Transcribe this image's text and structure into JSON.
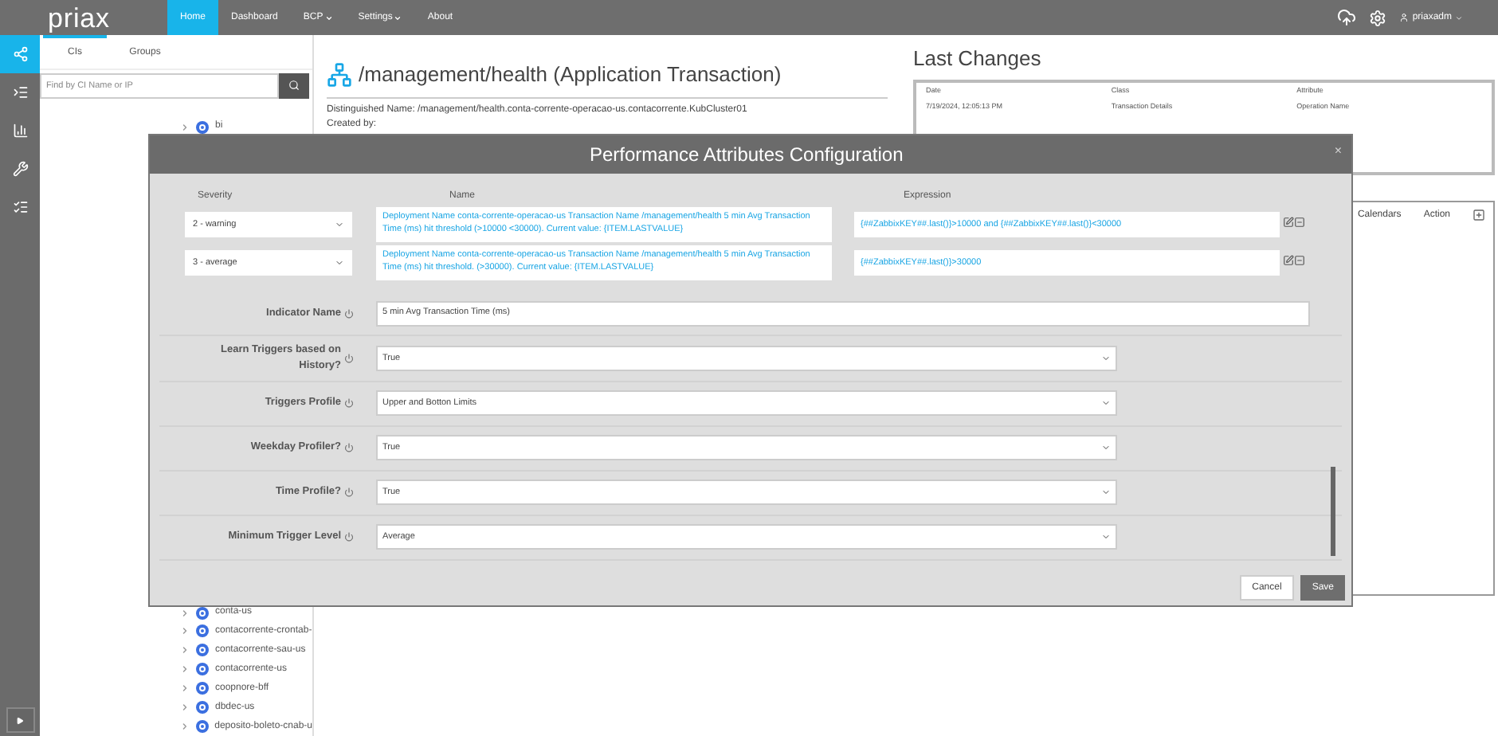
{
  "nav": {
    "logo": "priax",
    "items": [
      {
        "label": "Home",
        "selected": true,
        "dropdown": false
      },
      {
        "label": "Dashboard",
        "selected": false,
        "dropdown": false
      },
      {
        "label": "BCP",
        "selected": false,
        "dropdown": true
      },
      {
        "label": "Settings",
        "selected": false,
        "dropdown": true
      },
      {
        "label": "About",
        "selected": false,
        "dropdown": false
      }
    ],
    "user": "priaxadm"
  },
  "rail": {
    "items": [
      {
        "kind": "share",
        "selected": true
      },
      {
        "kind": "list",
        "selected": false
      },
      {
        "kind": "chart",
        "selected": false
      },
      {
        "kind": "wrench",
        "selected": false
      },
      {
        "kind": "tasks",
        "selected": false
      }
    ]
  },
  "tree": {
    "tabs": [
      {
        "label": "CIs",
        "selected": true
      },
      {
        "label": "Groups",
        "selected": false
      }
    ],
    "search": {
      "placeholder": "Find by CI Name or IP"
    },
    "items_top": [
      "bi"
    ],
    "items_bottom": [
      "conta-us",
      "contacorrente-crontab-",
      "contacorrente-sau-us",
      "contacorrente-us",
      "coopnore-bff",
      "dbdec-us",
      "deposito-boleto-cnab-u"
    ]
  },
  "detail": {
    "title": "/management/health (Application Transaction)",
    "distinguished_name": "Distinguished Name: /management/health.conta-corrente-operacao-us.contacorrente.KubCluster01",
    "created_by": "Created by:"
  },
  "last_changes": {
    "title": "Last Changes",
    "columns": [
      "Date",
      "Class",
      "Attribute"
    ],
    "rows": [
      [
        "7/19/2024, 12:05:13 PM",
        "Transaction Details",
        "Operation Name"
      ]
    ]
  },
  "calendar_panel": {
    "columns": [
      "Calendars",
      "Action"
    ]
  },
  "modal": {
    "title": "Performance Attributes Configuration",
    "close": "×",
    "columns": [
      "Severity",
      "Name",
      "Expression"
    ],
    "triggers": [
      {
        "severity": "2 - warning",
        "name": "Deployment Name conta-corrente-operacao-us Transaction Name /management/health 5 min Avg Transaction Time (ms) hit threshold (>10000 <30000). Current value: {ITEM.LASTVALUE}",
        "expression": "{##ZabbixKEY##.last()}>10000 and {##ZabbixKEY##.last()}<30000"
      },
      {
        "severity": "3 - average",
        "name": "Deployment Name conta-corrente-operacao-us Transaction Name /management/health 5 min Avg Transaction Time (ms) hit threshold. (>30000). Current value: {ITEM.LASTVALUE}",
        "expression": "{##ZabbixKEY##.last()}>30000"
      }
    ],
    "fields": [
      {
        "kind": "input",
        "label": "Indicator Name",
        "value": "5 min Avg Transaction Time (ms)"
      },
      {
        "kind": "select",
        "label": "Learn Triggers based on History?",
        "value": "True"
      },
      {
        "kind": "select",
        "label": "Triggers Profile",
        "value": "Upper and Botton Limits"
      },
      {
        "kind": "select",
        "label": "Weekday Profiler?",
        "value": "True"
      },
      {
        "kind": "select",
        "label": "Time Profile?",
        "value": "True"
      },
      {
        "kind": "select",
        "label": "Minimum Trigger Level",
        "value": "Average"
      }
    ],
    "buttons": [
      {
        "kind": "cancel",
        "label": "Cancel"
      },
      {
        "kind": "save",
        "label": "Save"
      }
    ]
  }
}
